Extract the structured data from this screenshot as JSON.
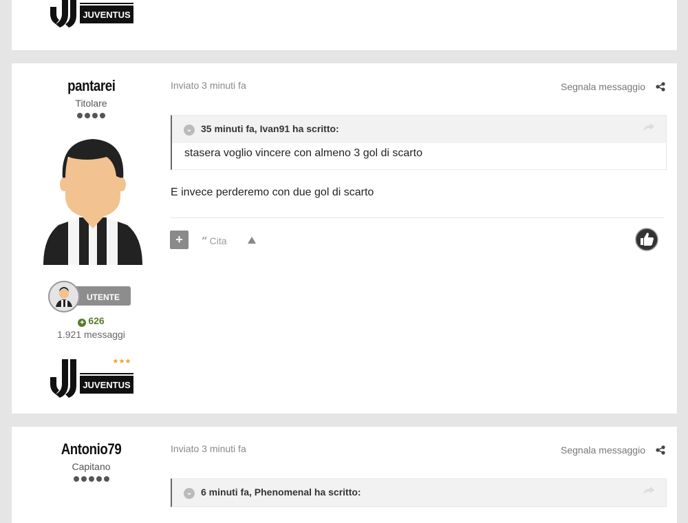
{
  "posts": [
    {
      "author": {
        "name": "pantarei",
        "rank": "Titolare",
        "pips": 4,
        "badge_label": "UTENTE",
        "reputation": "626",
        "posts_count": "1.921 messaggi",
        "club_logo_text": "JUVENTUS"
      },
      "meta": {
        "posted": "Inviato 3 minuti fa",
        "report": "Segnala messaggio"
      },
      "quote": {
        "header": "35 minuti fa, Ivan91 ha scritto:",
        "body": "stasera voglio vincere con almeno 3 gol di scarto"
      },
      "text": "E invece perderemo con due gol di scarto",
      "actions": {
        "cita": "Cita"
      }
    },
    {
      "author": {
        "name": "Antonio79",
        "rank": "Capitano",
        "pips": 5
      },
      "meta": {
        "posted": "Inviato 3 minuti fa",
        "report": "Segnala messaggio"
      },
      "quote": {
        "header": "6 minuti fa, Phenomenal ha scritto:"
      }
    }
  ],
  "previous_post": {
    "club_logo_text": "JUVENTUS"
  },
  "icons": {
    "share": "share-icon",
    "like": "thumbs-up-icon",
    "quote_toggle": "chevron-down-icon",
    "quote_goto": "forward-arrow-icon",
    "plus": "plus-icon",
    "vote_up": "arrow-up-icon",
    "rep_plus": "plus-circle-icon"
  },
  "colors": {
    "reputation": "#5c7a2c",
    "accent_star": "#f7a21b"
  }
}
